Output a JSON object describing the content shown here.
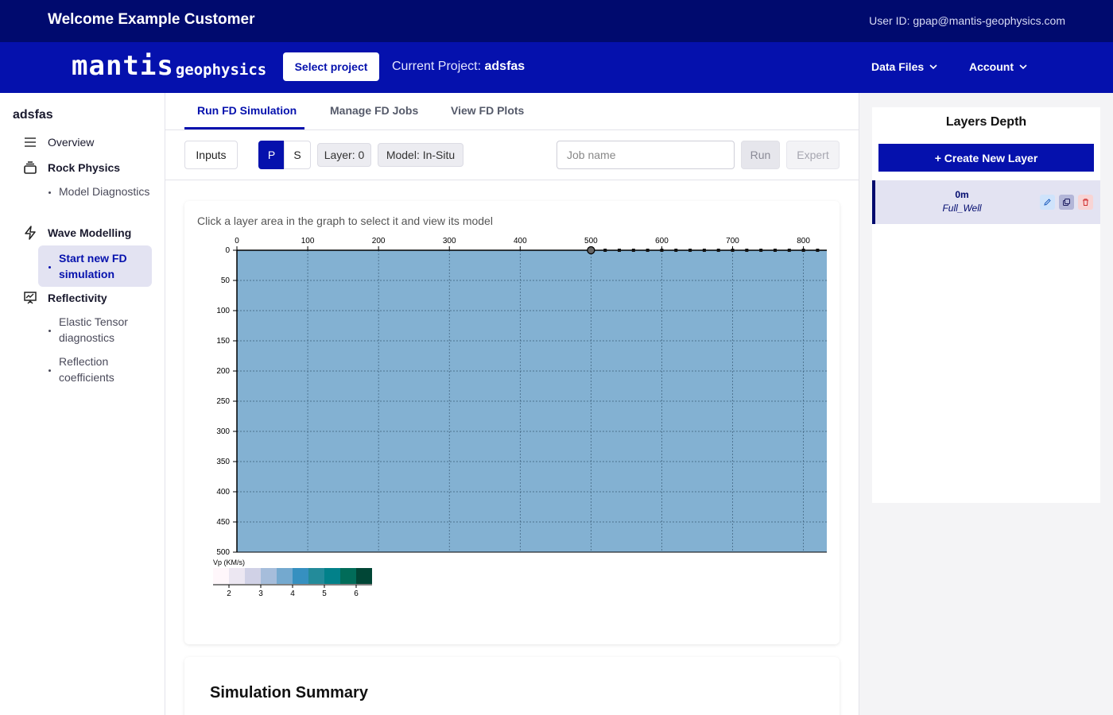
{
  "header": {
    "welcome": "Welcome Example Customer",
    "user_id": "User ID: gpap@mantis-geophysics.com"
  },
  "navbar": {
    "logo_main": "mantis",
    "logo_sub": "geophysics",
    "select_project": "Select project",
    "current_project_label": "Current Project:",
    "current_project_name": "adsfas",
    "menus": [
      "Data Files",
      "Account"
    ]
  },
  "sidebar": {
    "project": "adsfas",
    "overview": "Overview",
    "rock_physics": "Rock Physics",
    "model_diagnostics": "Model Diagnostics",
    "wave_modelling": "Wave Modelling",
    "start_fd": "Start new FD simulation",
    "reflectivity": "Reflectivity",
    "elastic_tensor": "Elastic Tensor diagnostics",
    "reflection_coeff": "Reflection coefficients"
  },
  "tabs": [
    "Run FD Simulation",
    "Manage FD Jobs",
    "View FD Plots"
  ],
  "toolbar": {
    "inputs": "Inputs",
    "p": "P",
    "s": "S",
    "layer": "Layer: 0",
    "model": "Model: In-Situ",
    "job_placeholder": "Job name",
    "run": "Run",
    "expert": "Expert"
  },
  "graph": {
    "hint": "Click a layer area in the graph to select it and view its model",
    "x_ticks": [
      "0",
      "100",
      "200",
      "300",
      "400",
      "500",
      "600",
      "700",
      "800"
    ],
    "y_ticks": [
      "0",
      "50",
      "100",
      "150",
      "200",
      "250",
      "300",
      "350",
      "400",
      "450",
      "500"
    ],
    "fill_color": "#83b1d2",
    "selected_marker_x": 500,
    "receiver_x": [
      520,
      540,
      560,
      580,
      600,
      620,
      640,
      660,
      680,
      700,
      720,
      740,
      760,
      780,
      800,
      820
    ],
    "colorbar_label": "Vp (KM/s)",
    "colorbar_ticks": [
      "2",
      "3",
      "4",
      "5",
      "6"
    ],
    "colorbar_colors": [
      "#fff7fb",
      "#ece7f2",
      "#d0d1e6",
      "#a6bddb",
      "#74a9cf",
      "#3690c0",
      "#238b9a",
      "#02818a",
      "#016c59",
      "#014636"
    ]
  },
  "summary": {
    "title": "Simulation Summary"
  },
  "layers_panel": {
    "title": "Layers Depth",
    "create": "+ Create New Layer",
    "layers": [
      {
        "depth": "0m",
        "name": "Full_Well"
      }
    ]
  },
  "colors": {
    "top": "#000a6e",
    "nav": "#0511ad"
  }
}
